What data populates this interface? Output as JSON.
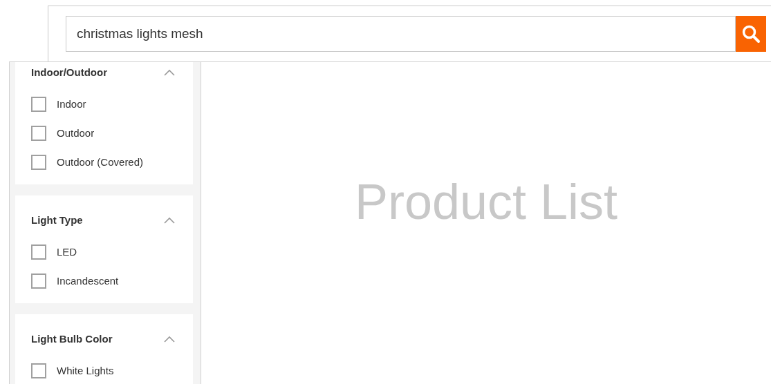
{
  "search": {
    "value": "christmas lights mesh"
  },
  "filters": [
    {
      "title": "Indoor/Outdoor",
      "expanded": true,
      "options": [
        {
          "label": "Indoor",
          "checked": false
        },
        {
          "label": "Outdoor",
          "checked": false
        },
        {
          "label": "Outdoor (Covered)",
          "checked": false
        }
      ]
    },
    {
      "title": "Light Type",
      "expanded": true,
      "options": [
        {
          "label": "LED",
          "checked": false
        },
        {
          "label": "Incandescent",
          "checked": false
        }
      ]
    },
    {
      "title": "Light Bulb Color",
      "expanded": true,
      "options": [
        {
          "label": "White Lights",
          "checked": false
        }
      ]
    }
  ],
  "main": {
    "placeholder_title": "Product List"
  }
}
